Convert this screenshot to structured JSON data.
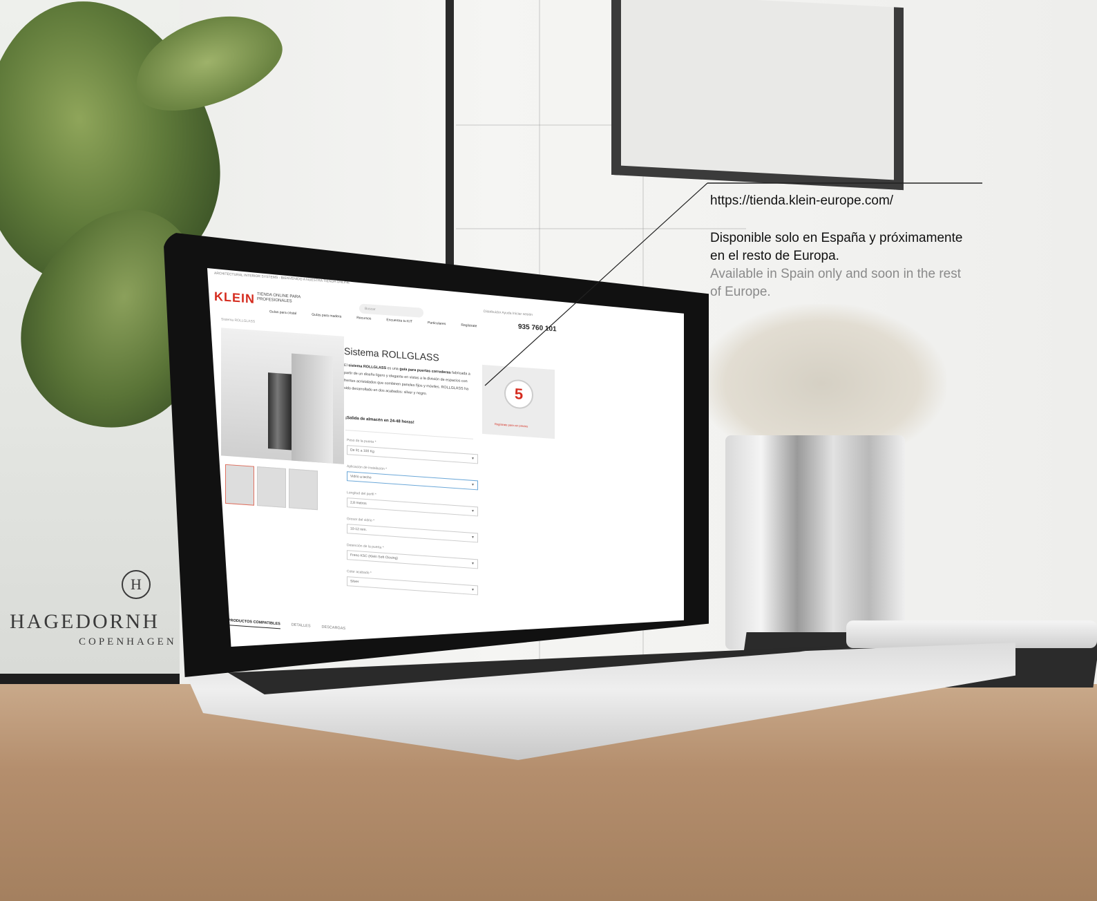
{
  "callout": {
    "url": "https://tienda.klein-europe.com/",
    "text_es": "Disponible solo en España y próximamente en el resto de Europa.",
    "text_en": "Available in Spain only and soon in the rest of Europe."
  },
  "brand": {
    "logo": "H",
    "name": "HAGEDORNH",
    "city": "COPENHAGEN"
  },
  "site": {
    "topbar": "ARCHITECTURAL INTERIOR SYSTEMS - BIENVENIDO A NUESTRA TIENDA ONLINE",
    "logo": "KLEIN",
    "logo_sub": "TIENDA ONLINE PARA PROFESIONALES",
    "search_placeholder": "Buscar",
    "top_links": "Distribuidor   Ayuda   Iniciar sesión",
    "phone": "935 760 101",
    "nav": [
      "Guías para cristal",
      "Guías para madera",
      "Recursos",
      "Encuentra tu KIT",
      "Particulares",
      "Regístrate"
    ],
    "breadcrumb": "Sistema ROLLGLASS",
    "title": "Sistema ROLLGLASS",
    "desc_lead": "El",
    "desc_bold1": "sistema ROLLGLASS",
    "desc_mid": "es una",
    "desc_bold2": "guía para puertas correderas",
    "desc_rest": "fabricada a partir de un diseño ligero y elegante en vistas a la división de espacios con frentes acristalados que combinen paneles fijos y móviles. ROLLGLASS ha sido desarrollado en dos acabados: silver y negro.",
    "note": "¡Salida de almacén en 24-48 horas!",
    "fields": [
      {
        "label": "Peso de la puerta *",
        "value": "De 91 a 100 Kg"
      },
      {
        "label": "Aplicación de instalación *",
        "value": "Vidrio a techo"
      },
      {
        "label": "Longitud del perfil *",
        "value": "2,8 metros"
      },
      {
        "label": "Grosor del vidrio *",
        "value": "10-12 mm."
      },
      {
        "label": "Detención de la puerta *",
        "value": "Freno KSC (Klein Soft Closing)"
      },
      {
        "label": "Color acabado *",
        "value": "Silver"
      }
    ],
    "badge_number": "5",
    "badge_text": "Regístrate para ver precios",
    "tabs": [
      "PRODUCTOS COMPATIBLES",
      "DETALLES",
      "DESCARGAS"
    ]
  },
  "colors": {
    "accent": "#d52b1e",
    "callout_text": "#111111",
    "callout_secondary": "#8a8a8a"
  }
}
